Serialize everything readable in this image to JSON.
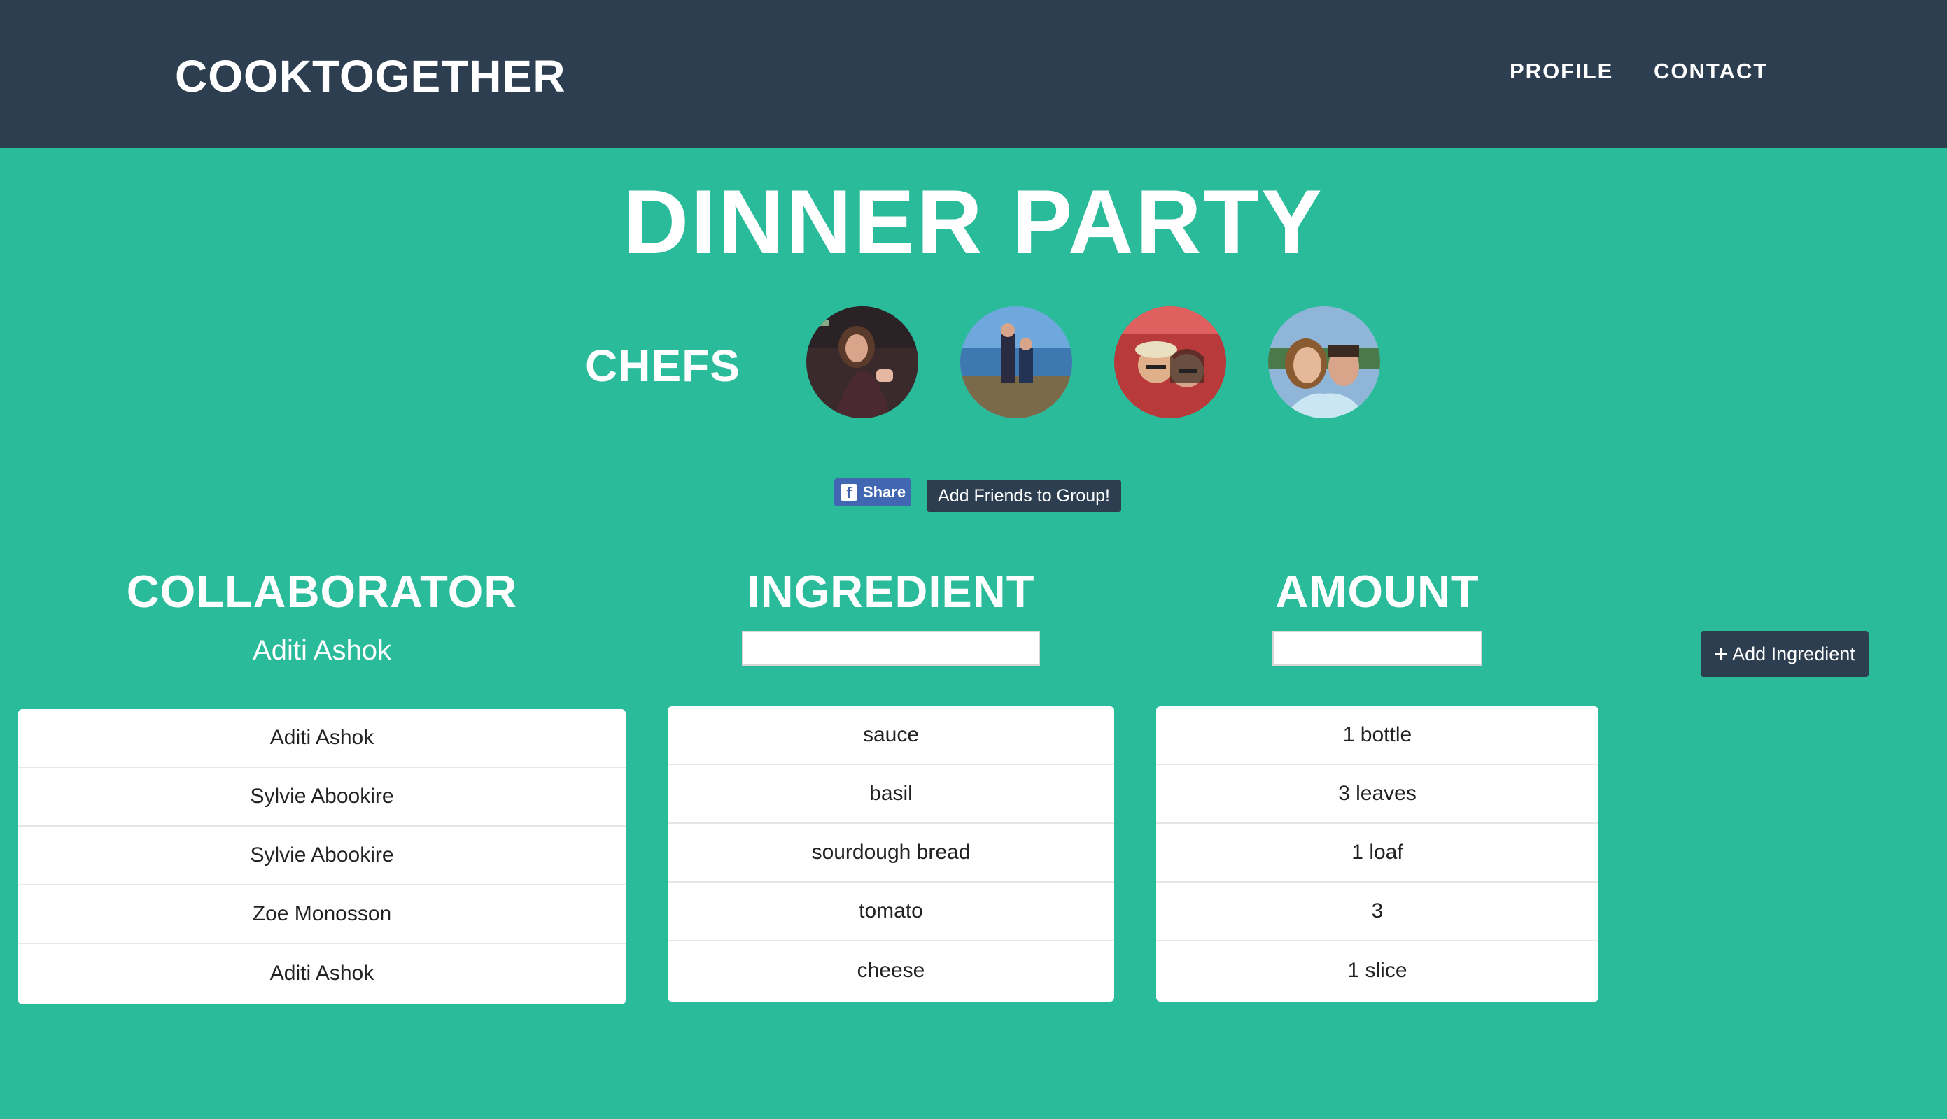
{
  "navbar": {
    "brand": "COOKTOGETHER",
    "links": [
      "PROFILE",
      "CONTACT"
    ]
  },
  "page": {
    "title": "DINNER PARTY",
    "chefs_label": "CHEFS"
  },
  "avatars": [
    {
      "name": "chef-avatar-1"
    },
    {
      "name": "chef-avatar-2"
    },
    {
      "name": "chef-avatar-3"
    },
    {
      "name": "chef-avatar-4"
    }
  ],
  "share": {
    "fb_icon": "f",
    "fb_label": "Share",
    "add_friends_label": "Add Friends to Group!"
  },
  "columns": {
    "collaborator": "COLLABORATOR",
    "ingredient": "INGREDIENT",
    "amount": "AMOUNT"
  },
  "current_collaborator": "Aditi Ashok",
  "inputs": {
    "ingredient_value": "",
    "amount_value": ""
  },
  "add_ingredient": {
    "icon": "+",
    "label": "Add Ingredient"
  },
  "collaborators": [
    "Aditi Ashok",
    "Sylvie Abookire",
    "Sylvie Abookire",
    "Zoe Monosson",
    "Aditi Ashok"
  ],
  "ingredients": [
    "sauce",
    "basil",
    "sourdough bread",
    "tomato",
    "cheese"
  ],
  "amounts": [
    "1 bottle",
    "3 leaves",
    "1 loaf",
    "3",
    "1 slice"
  ],
  "colors": {
    "navbar": "#2d3e50",
    "background": "#2abb9b",
    "facebook": "#4267b2"
  }
}
